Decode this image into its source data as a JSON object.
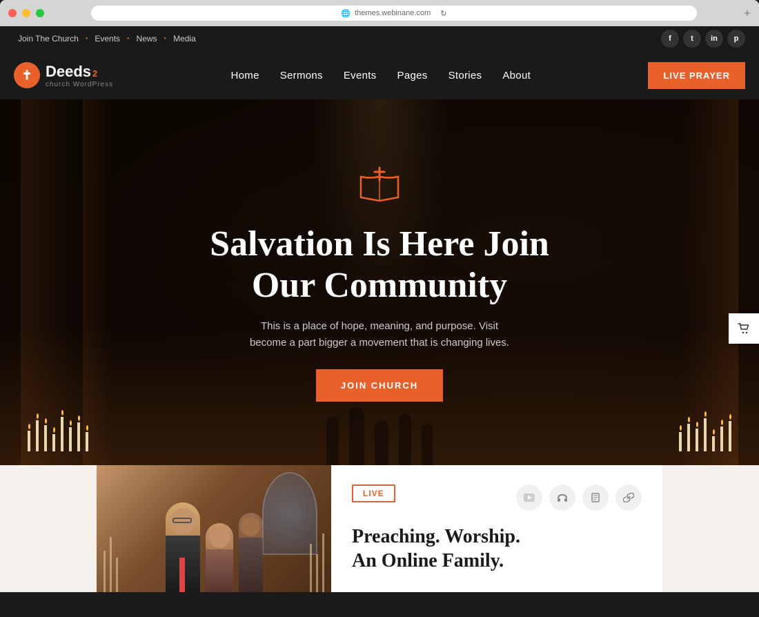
{
  "browser": {
    "url": "themes.webinane.com",
    "refresh_icon": "↻",
    "globe_icon": "🌐",
    "plus_icon": "+"
  },
  "topbar": {
    "links": [
      {
        "label": "Join The Church",
        "has_dot": true
      },
      {
        "label": "Events",
        "has_dot": true
      },
      {
        "label": "News",
        "has_dot": true
      },
      {
        "label": "Media",
        "has_dot": false
      }
    ],
    "social": [
      {
        "label": "f",
        "name": "facebook"
      },
      {
        "label": "t",
        "name": "twitter"
      },
      {
        "label": "in",
        "name": "linkedin"
      },
      {
        "label": "p",
        "name": "pinterest"
      }
    ]
  },
  "logo": {
    "icon": "✝",
    "brand": "Deeds",
    "superscript": "2",
    "tagline": "church WordPress"
  },
  "nav": {
    "links": [
      {
        "label": "Home"
      },
      {
        "label": "Sermons"
      },
      {
        "label": "Events"
      },
      {
        "label": "Pages"
      },
      {
        "label": "Stories"
      },
      {
        "label": "About"
      }
    ],
    "cta_label": "LIVE PRAYER"
  },
  "hero": {
    "title": "Salvation Is Here Join Our Community",
    "subtitle": "This is a place of hope, meaning, and purpose. Visit become a part bigger a movement that is changing lives.",
    "cta_label": "JOIN CHURCH"
  },
  "bottom": {
    "live_label": "LIVE",
    "title_line1": "Preaching. Worship.",
    "title_line2": "An Online Family.",
    "icons": [
      {
        "name": "youtube",
        "symbol": "▶"
      },
      {
        "name": "headphones",
        "symbol": "◎"
      },
      {
        "name": "document",
        "symbol": "📄"
      },
      {
        "name": "link",
        "symbol": "🔗"
      }
    ]
  }
}
